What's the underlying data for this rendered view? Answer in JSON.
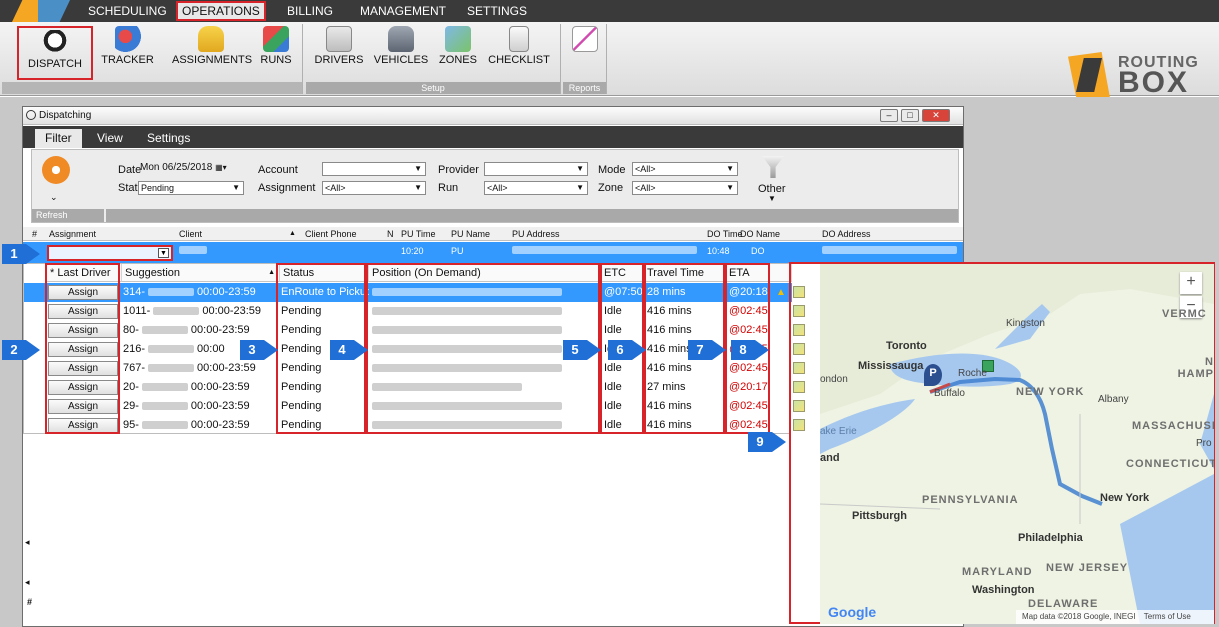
{
  "menubar": {
    "items": [
      "SCHEDULING",
      "OPERATIONS",
      "BILLING",
      "MANAGEMENT",
      "SETTINGS"
    ],
    "active": "OPERATIONS"
  },
  "ribbon": {
    "buttons": [
      "DISPATCH",
      "TRACKER",
      "ASSIGNMENTS",
      "RUNS",
      "DRIVERS",
      "VEHICLES",
      "ZONES",
      "CHECKLIST"
    ],
    "groups": [
      "Setup",
      "Reports"
    ]
  },
  "brand": {
    "line1": "ROUTING",
    "line2": "BOX"
  },
  "window": {
    "title": "Dispatching",
    "tabs": [
      "Filter",
      "View",
      "Settings"
    ]
  },
  "filter": {
    "refresh_label": "Refresh",
    "date_label": "Date",
    "date_value": "Mon 06/25/2018",
    "status_label": "Status",
    "status_value": "Pending",
    "account_label": "Account",
    "account_value": "",
    "assignment_label": "Assignment",
    "assignment_value": "<All>",
    "provider_label": "Provider",
    "provider_value": "",
    "run_label": "Run",
    "run_value": "<All>",
    "mode_label": "Mode",
    "mode_value": "<All>",
    "zone_label": "Zone",
    "zone_value": "<All>",
    "other_label": "Other"
  },
  "grid": {
    "headers": [
      "#",
      "Assignment",
      "Client",
      "Client Phone",
      "N",
      "PU Time",
      "PU Name",
      "PU Address",
      "DO Time",
      "DO Name",
      "DO Address"
    ],
    "row": {
      "pu_time": "10:20",
      "pu_name": "PU",
      "do_time": "10:48",
      "do_name": "DO"
    },
    "row_numbers": [
      "1",
      "2",
      "3"
    ]
  },
  "subgrid": {
    "headers": [
      "* Last Driver",
      "Suggestion",
      "Status",
      "Position (On Demand)",
      "ETC",
      "Travel Time",
      "ETA"
    ],
    "assign_label": "Assign",
    "rows": [
      {
        "suggestion": "314-",
        "window": "00:00-23:59",
        "status": "EnRoute to Pickup",
        "etc": "@07:50",
        "travel": "28 mins",
        "eta": "@20:18"
      },
      {
        "suggestion": "1011-",
        "window": "00:00-23:59",
        "status": "Pending",
        "etc": "Idle",
        "travel": "416 mins",
        "eta": "@02:45"
      },
      {
        "suggestion": "80-",
        "window": "00:00-23:59",
        "status": "Pending",
        "etc": "Idle",
        "travel": "416 mins",
        "eta": "@02:45"
      },
      {
        "suggestion": "216-",
        "window": "00:00",
        "status": "Pending",
        "etc": "Idle",
        "travel": "416 mins",
        "eta": "@02:45"
      },
      {
        "suggestion": "767-",
        "window": "00:00-23:59",
        "status": "Pending",
        "etc": "Idle",
        "travel": "416 mins",
        "eta": "@02:45"
      },
      {
        "suggestion": "20-",
        "window": "00:00-23:59",
        "status": "Pending",
        "etc": "Idle",
        "travel": "27 mins",
        "eta": "@20:17"
      },
      {
        "suggestion": "29-",
        "window": "00:00-23:59",
        "status": "Pending",
        "etc": "Idle",
        "travel": "416 mins",
        "eta": "@02:45"
      },
      {
        "suggestion": "95-",
        "window": "00:00-23:59",
        "status": "Pending",
        "etc": "Idle",
        "travel": "416 mins",
        "eta": "@02:45"
      }
    ]
  },
  "callouts": [
    "1",
    "2",
    "3",
    "4",
    "5",
    "6",
    "7",
    "8",
    "9"
  ],
  "map": {
    "labels": {
      "toronto": "Toronto",
      "mississauga": "Mississauga",
      "kingston": "Kingston",
      "rochester": "Roche",
      "buffalo": "Buffalo",
      "new_york_state": "NEW YORK",
      "albany": "Albany",
      "vermont": "VERMC",
      "new_hampshire": "N HAMP",
      "massachusetts": "MASSACHUSE",
      "providence": "Pro",
      "connecticut": "CONNECTICUT",
      "pennsylvania": "PENNSYLVANIA",
      "pittsburgh": "Pittsburgh",
      "new_york_city": "New York",
      "philadelphia": "Philadelphia",
      "maryland": "MARYLAND",
      "new_jersey": "NEW JERSEY",
      "washington": "Washington",
      "delaware": "DELAWARE",
      "lake_erie": "ake Erie",
      "ondon": "ondon",
      "land": "and"
    },
    "google": "Google",
    "attribution": "Map data ©2018 Google, INEGI",
    "terms": "Terms of Use",
    "zoom_in": "+",
    "zoom_out": "−"
  },
  "colors": {
    "accent": "#3399ff",
    "red": "#d6242a",
    "callout": "#1f6fd6"
  }
}
